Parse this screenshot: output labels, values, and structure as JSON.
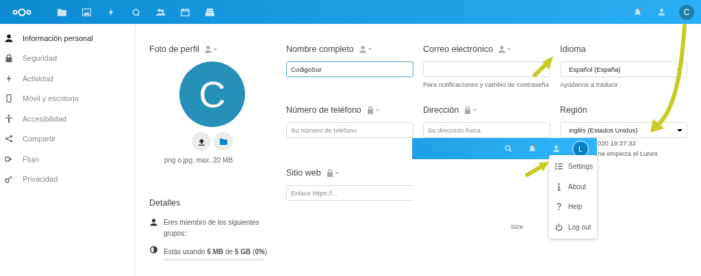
{
  "topbar": {
    "avatar_letter": "C",
    "notification_unread": true
  },
  "sidebar": {
    "items": [
      {
        "label": "Información personal",
        "selected": true
      },
      {
        "label": "Seguridad",
        "selected": false
      },
      {
        "label": "Actividad",
        "selected": false
      },
      {
        "label": "Móvil y escritorio",
        "selected": false
      },
      {
        "label": "Accesibilidad",
        "selected": false
      },
      {
        "label": "Compartir",
        "selected": false
      },
      {
        "label": "Flujo",
        "selected": false
      },
      {
        "label": "Privacidad",
        "selected": false
      }
    ]
  },
  "profile_photo": {
    "title": "Foto de perfil",
    "private": false,
    "avatar_letter": "C",
    "hint": "png o jpg, max. 20 MB"
  },
  "fields": [
    {
      "label": "Nombre completo",
      "private": false,
      "kind": "input",
      "value": "CodigoSur",
      "focused": true
    },
    {
      "label": "Correo electrónico",
      "private": false,
      "kind": "input",
      "focused": false,
      "hint": "Para notificaciones y cambio de contraseña"
    },
    {
      "label": "Idioma",
      "kind": "select",
      "value": "Español (España)",
      "link": "Ayúdanos a traducir"
    },
    {
      "label": "Número de teléfono",
      "private": true,
      "kind": "input",
      "placeholder": "Su número de teléfono",
      "focused": false
    },
    {
      "label": "Dirección",
      "private": true,
      "kind": "input",
      "placeholder": "Su dirección física",
      "focused": false
    },
    {
      "label": "Región",
      "kind": "select",
      "value": "inglés (Estados Unidos)",
      "notes": [
        "020 19:37:33",
        "na empieza el Lunes"
      ]
    },
    {
      "label": "Sitio web",
      "private": true,
      "kind": "input",
      "placeholder": "Enlace https://...",
      "focused": false
    }
  ],
  "details": {
    "title": "Detalles",
    "groups_text": "Eres miembro de los siguientes grupos:",
    "quota_text": "Estás usando **6 MB** de **5 GB** (**0%**)",
    "level": 0
  },
  "inset": {
    "avatar_letter": "L",
    "notification_unread": true,
    "menu": [
      {
        "label": "Settings"
      },
      {
        "label": "About"
      },
      {
        "label": "Help"
      },
      {
        "label": "Log out"
      }
    ],
    "column_header": "Size"
  }
}
